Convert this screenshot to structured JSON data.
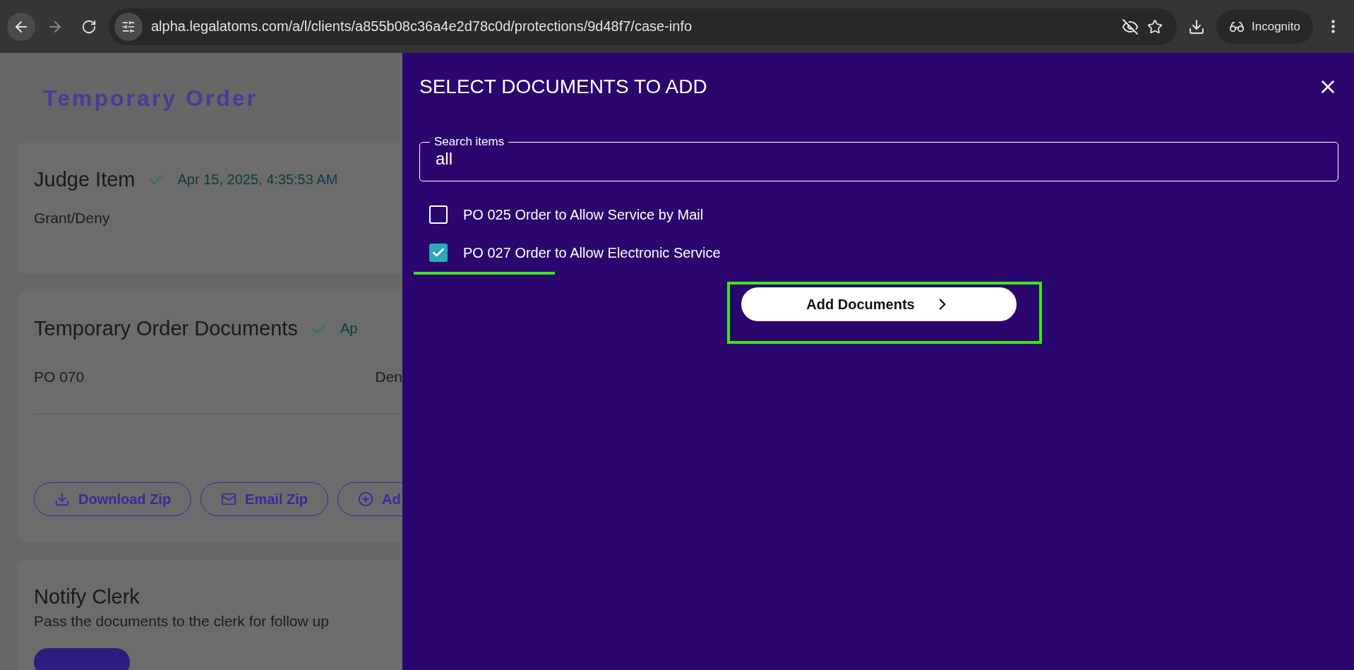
{
  "browser": {
    "url": "alpha.legalatoms.com/a/l/clients/a855b08c36a4e2d78c0d/protections/9d48f7/case-info",
    "profile_label": "Incognito"
  },
  "page": {
    "title": "Temporary Order",
    "cards": [
      {
        "kind": "status",
        "heading": "Judge Item",
        "done": true,
        "timestamp": "Apr 15, 2025, 4:35:53 AM",
        "body": "Grant/Deny"
      },
      {
        "kind": "documents",
        "heading": "Temporary Order Documents",
        "done": true,
        "timestamp": "Ap",
        "document": "PO 070",
        "decision": "Den",
        "actions": [
          {
            "kind": "download",
            "label": "Download Zip"
          },
          {
            "kind": "email",
            "label": "Email Zip"
          },
          {
            "kind": "add",
            "label": "Ad"
          }
        ]
      },
      {
        "kind": "notify",
        "heading": "Notify Clerk",
        "body": "Pass the documents to the clerk for follow up"
      }
    ]
  },
  "drawer": {
    "title": "SELECT DOCUMENTS TO ADD",
    "search": {
      "label": "Search items",
      "value": "all"
    },
    "items": [
      {
        "label": "PO 025 Order to Allow Service by Mail",
        "checked": false
      },
      {
        "label": "PO 027 Order to Allow Electronic Service",
        "checked": true
      }
    ],
    "button": "Add Documents"
  }
}
